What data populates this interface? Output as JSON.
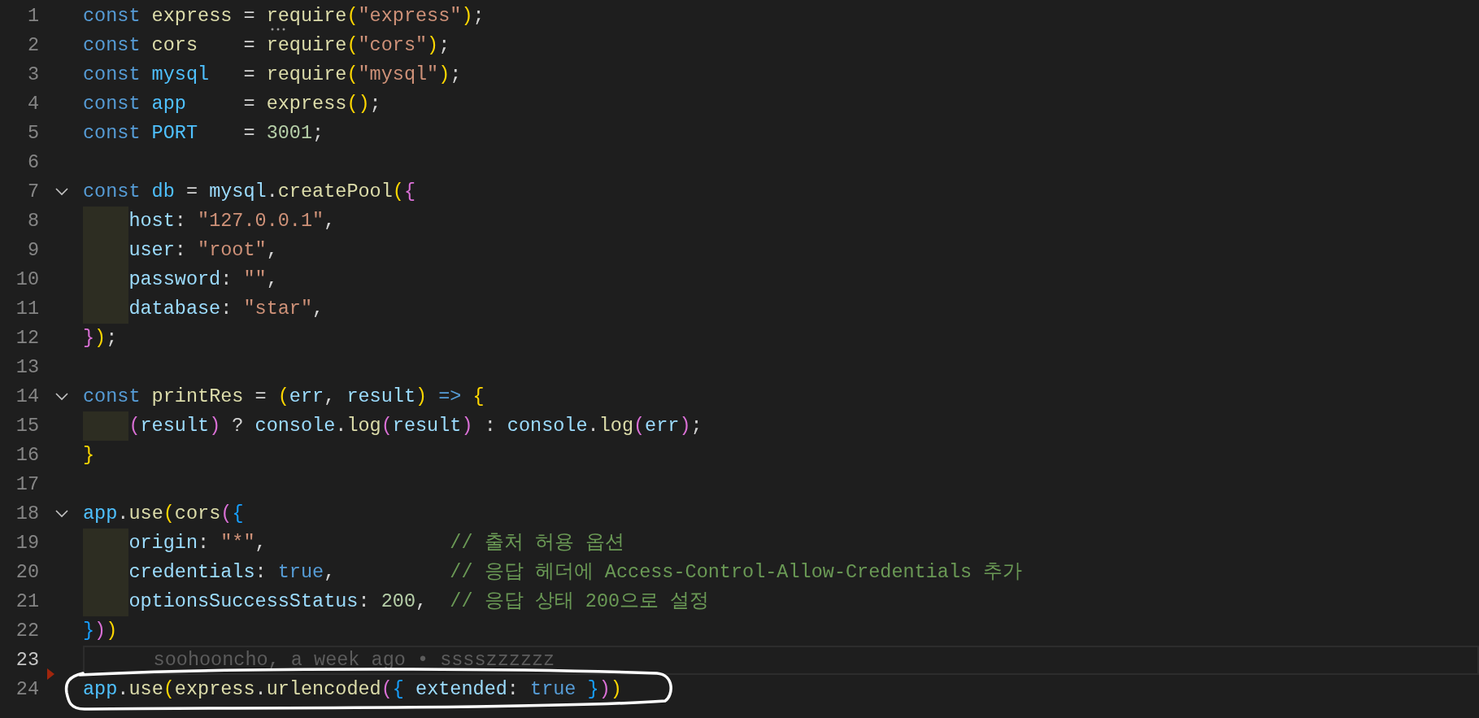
{
  "editor": {
    "lines": [
      {
        "number": "1",
        "fold": false,
        "indent": false,
        "current": false,
        "deleted_marker": false,
        "circled": false,
        "tokens": [
          {
            "text": "const",
            "kind": "kw"
          },
          {
            "text": " express",
            "kind": "fn"
          },
          {
            "text": " = ",
            "kind": "p"
          },
          {
            "text": "require",
            "kind": "fn_hint"
          },
          {
            "text": "(",
            "kind": "b1"
          },
          {
            "text": "\"express\"",
            "kind": "str"
          },
          {
            "text": ")",
            "kind": "b1"
          },
          {
            "text": ";",
            "kind": "p"
          }
        ]
      },
      {
        "number": "2",
        "fold": false,
        "indent": false,
        "current": false,
        "deleted_marker": false,
        "circled": false,
        "tokens": [
          {
            "text": "const",
            "kind": "kw"
          },
          {
            "text": " cors",
            "kind": "fn"
          },
          {
            "text": "    = ",
            "kind": "p"
          },
          {
            "text": "require",
            "kind": "fn"
          },
          {
            "text": "(",
            "kind": "b1"
          },
          {
            "text": "\"cors\"",
            "kind": "str"
          },
          {
            "text": ")",
            "kind": "b1"
          },
          {
            "text": ";",
            "kind": "p"
          }
        ]
      },
      {
        "number": "3",
        "fold": false,
        "indent": false,
        "current": false,
        "deleted_marker": false,
        "circled": false,
        "tokens": [
          {
            "text": "const",
            "kind": "kw"
          },
          {
            "text": " mysql",
            "kind": "const"
          },
          {
            "text": "   = ",
            "kind": "p"
          },
          {
            "text": "require",
            "kind": "fn"
          },
          {
            "text": "(",
            "kind": "b1"
          },
          {
            "text": "\"mysql\"",
            "kind": "str"
          },
          {
            "text": ")",
            "kind": "b1"
          },
          {
            "text": ";",
            "kind": "p"
          }
        ]
      },
      {
        "number": "4",
        "fold": false,
        "indent": false,
        "current": false,
        "deleted_marker": false,
        "circled": false,
        "tokens": [
          {
            "text": "const",
            "kind": "kw"
          },
          {
            "text": " app",
            "kind": "const"
          },
          {
            "text": "     = ",
            "kind": "p"
          },
          {
            "text": "express",
            "kind": "fn"
          },
          {
            "text": "()",
            "kind": "b1"
          },
          {
            "text": ";",
            "kind": "p"
          }
        ]
      },
      {
        "number": "5",
        "fold": false,
        "indent": false,
        "current": false,
        "deleted_marker": false,
        "circled": false,
        "tokens": [
          {
            "text": "const",
            "kind": "kw"
          },
          {
            "text": " PORT",
            "kind": "const"
          },
          {
            "text": "    = ",
            "kind": "p"
          },
          {
            "text": "3001",
            "kind": "num"
          },
          {
            "text": ";",
            "kind": "p"
          }
        ]
      },
      {
        "number": "6",
        "fold": false,
        "indent": false,
        "current": false,
        "deleted_marker": false,
        "circled": false
      },
      {
        "number": "7",
        "fold": true,
        "indent": false,
        "current": false,
        "deleted_marker": false,
        "circled": false,
        "tokens": [
          {
            "text": "const",
            "kind": "kw"
          },
          {
            "text": " db",
            "kind": "const"
          },
          {
            "text": " = ",
            "kind": "p"
          },
          {
            "text": "mysql",
            "kind": "prop"
          },
          {
            "text": ".",
            "kind": "p"
          },
          {
            "text": "createPool",
            "kind": "fn"
          },
          {
            "text": "(",
            "kind": "b1"
          },
          {
            "text": "{",
            "kind": "b2"
          }
        ]
      },
      {
        "number": "8",
        "fold": false,
        "indent": true,
        "current": false,
        "deleted_marker": false,
        "circled": false,
        "tokens": [
          {
            "text": "host",
            "kind": "prop"
          },
          {
            "text": ": ",
            "kind": "p"
          },
          {
            "text": "\"127.0.0.1\"",
            "kind": "str"
          },
          {
            "text": ",",
            "kind": "p"
          }
        ]
      },
      {
        "number": "9",
        "fold": false,
        "indent": true,
        "current": false,
        "deleted_marker": false,
        "circled": false,
        "tokens": [
          {
            "text": "user",
            "kind": "prop"
          },
          {
            "text": ": ",
            "kind": "p"
          },
          {
            "text": "\"root\"",
            "kind": "str"
          },
          {
            "text": ",",
            "kind": "p"
          }
        ]
      },
      {
        "number": "10",
        "fold": false,
        "indent": true,
        "current": false,
        "deleted_marker": false,
        "circled": false,
        "tokens": [
          {
            "text": "password",
            "kind": "prop"
          },
          {
            "text": ": ",
            "kind": "p"
          },
          {
            "text": "\"\"",
            "kind": "str"
          },
          {
            "text": ",",
            "kind": "p"
          }
        ]
      },
      {
        "number": "11",
        "fold": false,
        "indent": true,
        "current": false,
        "deleted_marker": false,
        "circled": false,
        "tokens": [
          {
            "text": "database",
            "kind": "prop"
          },
          {
            "text": ": ",
            "kind": "p"
          },
          {
            "text": "\"star\"",
            "kind": "str"
          },
          {
            "text": ",",
            "kind": "p"
          }
        ]
      },
      {
        "number": "12",
        "fold": false,
        "indent": false,
        "current": false,
        "deleted_marker": false,
        "circled": false,
        "tokens": [
          {
            "text": "}",
            "kind": "b2"
          },
          {
            "text": ")",
            "kind": "b1"
          },
          {
            "text": ";",
            "kind": "p"
          }
        ]
      },
      {
        "number": "13",
        "fold": false,
        "indent": false,
        "current": false,
        "deleted_marker": false,
        "circled": false
      },
      {
        "number": "14",
        "fold": true,
        "indent": false,
        "current": false,
        "deleted_marker": false,
        "circled": false,
        "tokens": [
          {
            "text": "const",
            "kind": "kw"
          },
          {
            "text": " printRes",
            "kind": "fn"
          },
          {
            "text": " = ",
            "kind": "p"
          },
          {
            "text": "(",
            "kind": "b1"
          },
          {
            "text": "err",
            "kind": "prop"
          },
          {
            "text": ", ",
            "kind": "p"
          },
          {
            "text": "result",
            "kind": "prop"
          },
          {
            "text": ")",
            "kind": "b1"
          },
          {
            "text": " =>",
            "kind": "kw"
          },
          {
            "text": " {",
            "kind": "b1"
          }
        ]
      },
      {
        "number": "15",
        "fold": false,
        "indent": true,
        "current": false,
        "deleted_marker": false,
        "circled": false,
        "tokens": [
          {
            "text": "(",
            "kind": "b2"
          },
          {
            "text": "result",
            "kind": "prop"
          },
          {
            "text": ")",
            "kind": "b2"
          },
          {
            "text": " ? ",
            "kind": "p"
          },
          {
            "text": "console",
            "kind": "prop"
          },
          {
            "text": ".",
            "kind": "p"
          },
          {
            "text": "log",
            "kind": "fn"
          },
          {
            "text": "(",
            "kind": "b2"
          },
          {
            "text": "result",
            "kind": "prop"
          },
          {
            "text": ")",
            "kind": "b2"
          },
          {
            "text": " : ",
            "kind": "p"
          },
          {
            "text": "console",
            "kind": "prop"
          },
          {
            "text": ".",
            "kind": "p"
          },
          {
            "text": "log",
            "kind": "fn"
          },
          {
            "text": "(",
            "kind": "b2"
          },
          {
            "text": "err",
            "kind": "prop"
          },
          {
            "text": ")",
            "kind": "b2"
          },
          {
            "text": ";",
            "kind": "p"
          }
        ]
      },
      {
        "number": "16",
        "fold": false,
        "indent": false,
        "current": false,
        "deleted_marker": false,
        "circled": false,
        "tokens": [
          {
            "text": "}",
            "kind": "b1"
          }
        ]
      },
      {
        "number": "17",
        "fold": false,
        "indent": false,
        "current": false,
        "deleted_marker": false,
        "circled": false
      },
      {
        "number": "18",
        "fold": true,
        "indent": false,
        "current": false,
        "deleted_marker": false,
        "circled": false,
        "tokens": [
          {
            "text": "app",
            "kind": "const"
          },
          {
            "text": ".",
            "kind": "p"
          },
          {
            "text": "use",
            "kind": "fn"
          },
          {
            "text": "(",
            "kind": "b1"
          },
          {
            "text": "cors",
            "kind": "fn"
          },
          {
            "text": "(",
            "kind": "b2"
          },
          {
            "text": "{",
            "kind": "b3"
          }
        ]
      },
      {
        "number": "19",
        "fold": false,
        "indent": true,
        "current": false,
        "deleted_marker": false,
        "circled": false,
        "tokens": [
          {
            "text": "origin",
            "kind": "prop"
          },
          {
            "text": ": ",
            "kind": "p"
          },
          {
            "text": "\"*\"",
            "kind": "str"
          },
          {
            "text": ",                ",
            "kind": "p"
          },
          {
            "text": "// 출처 허용 옵션",
            "kind": "cm"
          }
        ]
      },
      {
        "number": "20",
        "fold": false,
        "indent": true,
        "current": false,
        "deleted_marker": false,
        "circled": false,
        "tokens": [
          {
            "text": "credentials",
            "kind": "prop"
          },
          {
            "text": ": ",
            "kind": "p"
          },
          {
            "text": "true",
            "kind": "kw"
          },
          {
            "text": ",          ",
            "kind": "p"
          },
          {
            "text": "// 응답 헤더에 Access-Control-Allow-Credentials 추가",
            "kind": "cm"
          }
        ]
      },
      {
        "number": "21",
        "fold": false,
        "indent": true,
        "current": false,
        "deleted_marker": false,
        "circled": false,
        "tokens": [
          {
            "text": "optionsSuccessStatus",
            "kind": "prop"
          },
          {
            "text": ": ",
            "kind": "p"
          },
          {
            "text": "200",
            "kind": "num"
          },
          {
            "text": ",  ",
            "kind": "p"
          },
          {
            "text": "// 응답 상태 200으로 설정",
            "kind": "cm"
          }
        ]
      },
      {
        "number": "22",
        "fold": false,
        "indent": false,
        "current": false,
        "deleted_marker": false,
        "circled": false,
        "tokens": [
          {
            "text": "}",
            "kind": "b3"
          },
          {
            "text": ")",
            "kind": "b2"
          },
          {
            "text": ")",
            "kind": "b1"
          }
        ]
      },
      {
        "number": "23",
        "fold": false,
        "indent": false,
        "current": true,
        "deleted_marker": false,
        "circled": false,
        "tokens": [
          {
            "text": "soohooncho, a week ago • sssszzzzzz",
            "kind": "ghost"
          }
        ]
      },
      {
        "number": "24",
        "fold": false,
        "indent": false,
        "current": false,
        "deleted_marker": true,
        "circled": true,
        "tokens": [
          {
            "text": "app",
            "kind": "const"
          },
          {
            "text": ".",
            "kind": "p"
          },
          {
            "text": "use",
            "kind": "fn"
          },
          {
            "text": "(",
            "kind": "b1"
          },
          {
            "text": "express",
            "kind": "fn"
          },
          {
            "text": ".",
            "kind": "p"
          },
          {
            "text": "urlencoded",
            "kind": "fn"
          },
          {
            "text": "(",
            "kind": "b2"
          },
          {
            "text": "{",
            "kind": "b3"
          },
          {
            "text": " extended",
            "kind": "prop"
          },
          {
            "text": ": ",
            "kind": "p"
          },
          {
            "text": "true",
            "kind": "kw"
          },
          {
            "text": " }",
            "kind": "b3"
          },
          {
            "text": ")",
            "kind": "b2"
          },
          {
            "text": ")",
            "kind": "b1"
          }
        ]
      }
    ]
  }
}
